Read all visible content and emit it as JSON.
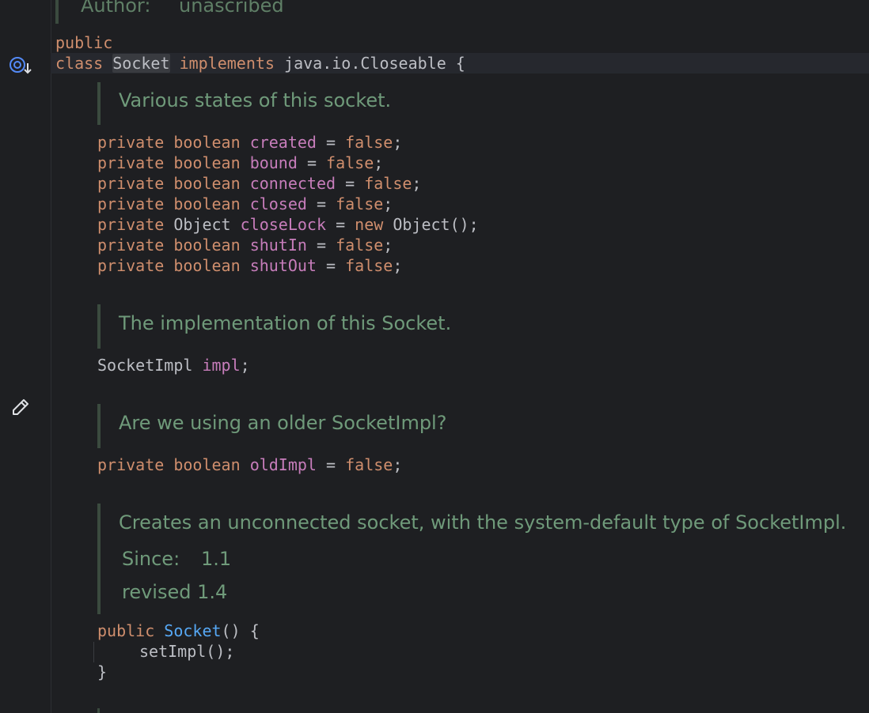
{
  "docs": {
    "author_label": "Author:",
    "author_value": "unascribed",
    "states": "Various states of this socket.",
    "impl": "The implementation of this Socket.",
    "older": "Are we using an older SocketImpl?",
    "ctor_desc": "Creates an unconnected socket, with the system-default type of SocketImpl.",
    "since_label": "Since:",
    "since_value": "1.1",
    "revised": "revised 1.4"
  },
  "code": {
    "public_kw": "public",
    "class_kw": "class",
    "class_name": "Socket",
    "implements_kw": "implements",
    "interface": "java.io.Closeable",
    "open_brace": "{",
    "fields": [
      {
        "mod": "private",
        "type": "boolean",
        "name": "created",
        "eq": "=",
        "value": "false",
        "end": ";"
      },
      {
        "mod": "private",
        "type": "boolean",
        "name": "bound",
        "eq": "=",
        "value": "false",
        "end": ";"
      },
      {
        "mod": "private",
        "type": "boolean",
        "name": "connected",
        "eq": "=",
        "value": "false",
        "end": ";"
      },
      {
        "mod": "private",
        "type": "boolean",
        "name": "closed",
        "eq": "=",
        "value": "false",
        "end": ";"
      },
      {
        "mod": "private",
        "type": "Object",
        "name": "closeLock",
        "eq": "=",
        "new_kw": "new",
        "value": "Object()",
        "end": ";"
      },
      {
        "mod": "private",
        "type": "boolean",
        "name": "shutIn",
        "eq": "=",
        "value": "false",
        "end": ";"
      },
      {
        "mod": "private",
        "type": "boolean",
        "name": "shutOut",
        "eq": "=",
        "value": "false",
        "end": ";"
      }
    ],
    "impl_field": {
      "type": "SocketImpl",
      "name": "impl",
      "end": ";"
    },
    "old_field": {
      "mod": "private",
      "type": "boolean",
      "name": "oldImpl",
      "eq": "=",
      "value": "false",
      "end": ";"
    },
    "ctor": {
      "mod": "public",
      "name": "Socket",
      "parens": "()",
      "open": "{",
      "body": "setImpl();",
      "close": "}"
    }
  },
  "gutter_icons": [
    "implemented-by-icon",
    "edit-pencil-icon"
  ],
  "colors": {
    "background": "#1e1f22",
    "keyword": "#cf8e6d",
    "field": "#c77dbb",
    "constructor": "#56a8f5",
    "doc_text": "#6f9a7a",
    "plain": "#bcbec4"
  }
}
